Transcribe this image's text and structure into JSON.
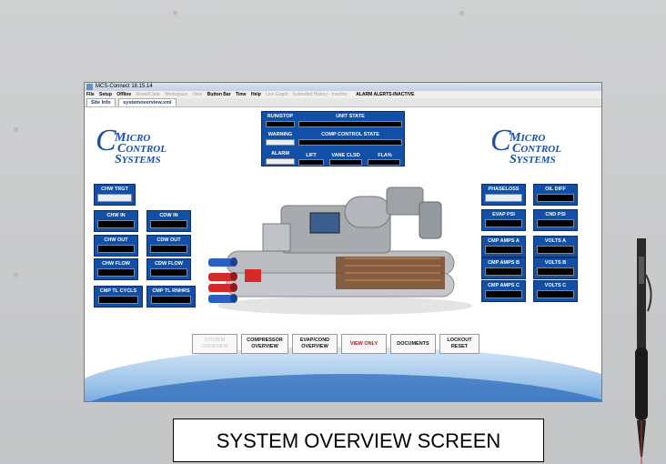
{
  "window": {
    "title": "MCS-Connect 18.15.14"
  },
  "menu": {
    "items": [
      {
        "label": "File",
        "dim": false
      },
      {
        "label": "Setup",
        "dim": false
      },
      {
        "label": "Offline",
        "dim": false
      },
      {
        "label": "Reset/Clear",
        "dim": true
      },
      {
        "label": "Workspace",
        "dim": true
      },
      {
        "label": "View",
        "dim": true
      },
      {
        "label": "Button Bar",
        "dim": false
      },
      {
        "label": "Time",
        "dim": false
      },
      {
        "label": "Help",
        "dim": false
      },
      {
        "label": "Live Graph",
        "dim": true
      },
      {
        "label": "Extended History - Inactive",
        "dim": true
      }
    ],
    "alerts": "ALARM ALERTS-INACTIVE"
  },
  "tabs": [
    "Site Info",
    "systemoverview.xml"
  ],
  "logo": {
    "line1": "ICRO",
    "line2": "ONTROL",
    "line3": "YSTEMS"
  },
  "status_panel": {
    "run_stop": "RUN/STOP",
    "unit_state": "UNIT STATE",
    "warning": "WARNING",
    "comp_control_state": "COMP CONTROL STATE",
    "alarm": "ALARM",
    "lift": "LIFT",
    "vane_clsd": "VANE CLSD",
    "fla": "FLA%"
  },
  "left_panels": {
    "chw_trgt": "CHW TRGT",
    "chw_in": "CHW IN",
    "cdw_in": "CDW IN",
    "chw_out": "CHW OUT",
    "cdw_out": "CDW OUT",
    "chw_flow": "CHW FLOW",
    "cdw_flow": "CDW FLOW",
    "cmp_tl_cycls": "CMP TL CYCLS",
    "cmp_tl_rnhrs": "CMP TL RNHRS"
  },
  "right_panels": {
    "phaseloss": "PHASELOSS",
    "oil_diff": "OIL DIFF",
    "evap_psi": "EVAP PSI",
    "cnd_psi": "CND PSI",
    "cmp_amps_a": "CMP AMPS A",
    "volts_a": "VOLTS A",
    "cmp_amps_b": "CMP AMPS B",
    "volts_b": "VOLTS B",
    "cmp_amps_c": "CMP AMPS C",
    "volts_c": "VOLTS C"
  },
  "buttons": {
    "system_overview": "SYSTEM OVERVIEW",
    "compressor_overview": "COMPRESSOR OVERVIEW",
    "evap_cond_overview": "EVAP/COND OVERVIEW",
    "view_only": "VIEW ONLY",
    "documents": "DOCUMENTS",
    "lockout_reset": "LOCKOUT RESET"
  },
  "caption": "SYSTEM OVERVIEW SCREEN",
  "colors": {
    "panel": "#1250a8",
    "logo": "#1d4fa3",
    "view_only": "#e0001b"
  }
}
